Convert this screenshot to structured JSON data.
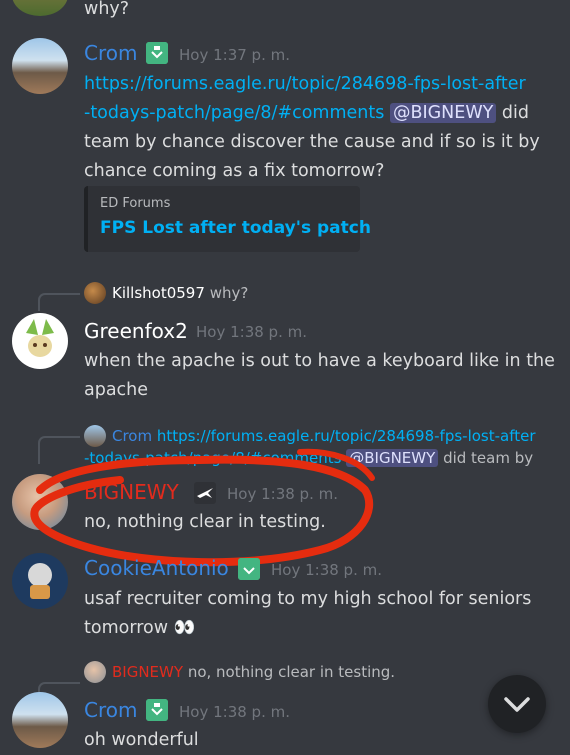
{
  "colors": {
    "bg": "#36393f",
    "link": "#00b0f4",
    "crom": "#3a86e0",
    "bignewy": "#e22b1d",
    "cookie": "#3a86e0",
    "annotation": "#e52c0f"
  },
  "top_fragment": {
    "text": "why?"
  },
  "msg1": {
    "author": "Crom",
    "badge_icon": "green-shield-icon",
    "timestamp": "Hoy 1:37 p. m.",
    "link_line1": "https://forums.eagle.ru/topic/284698-fps-lost-after",
    "link_line2": "-todays-patch/page/8/#comments",
    "mention": "@BIGNEWY",
    "text_after_mention": "did",
    "line3": "team by chance discover the cause and if so is it by",
    "line4": "chance coming as a fix tomorrow?",
    "embed": {
      "provider": "ED Forums",
      "title": "FPS Lost after today's patch"
    }
  },
  "msg2": {
    "reply": {
      "author": "Killshot0597",
      "text": "why?"
    },
    "author": "Greenfox2",
    "timestamp": "Hoy 1:38 p. m.",
    "line1": "when the apache is out to have a keyboard like in the",
    "line2": "apache"
  },
  "msg3": {
    "reply": {
      "author": "Crom",
      "link": "https://forums.eagle.ru/topic/284698-fps-lost-after",
      "link2": "-todays-patch/page/8/#comments",
      "mention": "@BIGNEWY",
      "rest": "did team by"
    },
    "author": "BIGNEWY",
    "badge_icon": "jet-icon",
    "timestamp": "Hoy 1:38 p. m.",
    "line1": "no, nothing clear in testing."
  },
  "msg4": {
    "author": "CookieAntonio",
    "badge_icon": "green-shield-icon",
    "timestamp": "Hoy 1:38 p. m.",
    "line1": "usaf recruiter coming to my high school for seniors",
    "line2": "tomorrow",
    "emoji": "👀"
  },
  "msg5": {
    "reply": {
      "author": "BIGNEWY",
      "text": "no, nothing clear in testing."
    },
    "author": "Crom",
    "badge_icon": "green-shield-icon",
    "timestamp": "Hoy 1:38 p. m.",
    "line1": "oh wonderful"
  },
  "fab": {
    "icon": "chevron-down-icon"
  }
}
